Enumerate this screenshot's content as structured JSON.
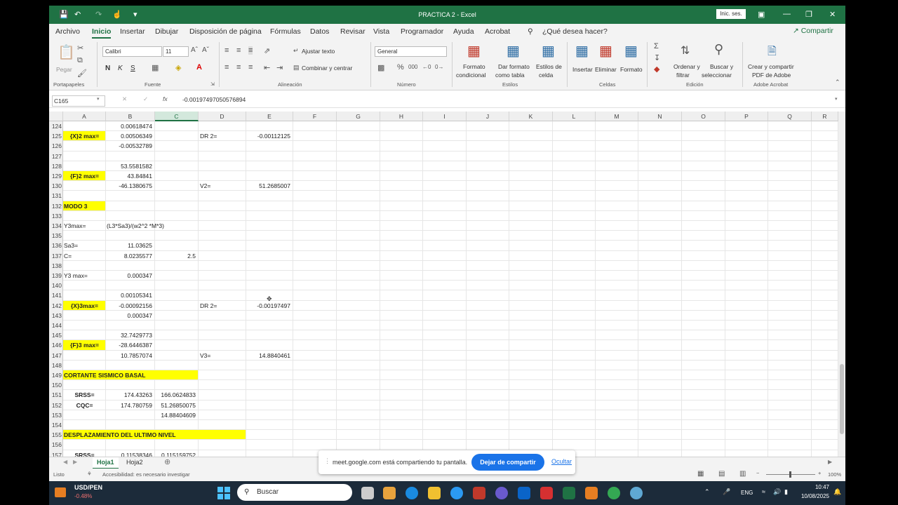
{
  "titlebar": {
    "title": "PRACTICA 2  -  Excel",
    "signin": "Inic. ses."
  },
  "menu": {
    "tabs": [
      "Archivo",
      "Inicio",
      "Insertar",
      "Dibujar",
      "Disposición de página",
      "Fórmulas",
      "Datos",
      "Revisar",
      "Vista",
      "Programador",
      "Ayuda",
      "Acrobat"
    ],
    "active_tab": "Inicio",
    "tell_me": "¿Qué desea hacer?",
    "share": "Compartir"
  },
  "ribbon": {
    "paste": "Pegar",
    "font_name": "Calibri",
    "font_size": "11",
    "bold": "N",
    "italic": "K",
    "underline": "S",
    "wrap_text": "Ajustar texto",
    "merge_center": "Combinar y centrar",
    "number_format": "General",
    "conditional_format_1": "Formato",
    "conditional_format_2": "condicional",
    "format_table_1": "Dar formato",
    "format_table_2": "como tabla",
    "cell_styles_1": "Estilos de",
    "cell_styles_2": "celda",
    "insert": "Insertar",
    "delete": "Eliminar",
    "format": "Formato",
    "sort_1": "Ordenar y",
    "sort_2": "filtrar",
    "find_1": "Buscar y",
    "find_2": "seleccionar",
    "pdf_1": "Crear y compartir",
    "pdf_2": "PDF de Adobe",
    "groups": [
      "Portapapeles",
      "Fuente",
      "Alineación",
      "Número",
      "Estilos",
      "Celdas",
      "Edición",
      "Adobe Acrobat"
    ]
  },
  "formula_bar": {
    "name_box": "C165",
    "fx": "fx",
    "formula": "-0.00197497050576894"
  },
  "columns": [
    "A",
    "B",
    "C",
    "D",
    "E",
    "F",
    "G",
    "H",
    "I",
    "J",
    "K",
    "L",
    "M",
    "N",
    "O",
    "P",
    "Q",
    "R"
  ],
  "selected_column": "C",
  "rows": [
    {
      "n": "124",
      "A": "",
      "B": "0.00618474",
      "C": "",
      "D": "",
      "E": ""
    },
    {
      "n": "125",
      "A": "{X}2 max=",
      "B": "0.00506349",
      "C": "",
      "D": "DR 2=",
      "E": "-0.00112125",
      "hlA": true
    },
    {
      "n": "126",
      "A": "",
      "B": "-0.00532789",
      "C": "",
      "D": "",
      "E": ""
    },
    {
      "n": "127",
      "A": "",
      "B": "",
      "C": "",
      "D": "",
      "E": ""
    },
    {
      "n": "128",
      "A": "",
      "B": "53.5581582",
      "C": "",
      "D": "",
      "E": ""
    },
    {
      "n": "129",
      "A": "{F}2 max=",
      "B": "43.84841",
      "C": "",
      "D": "",
      "E": "",
      "hlA": true
    },
    {
      "n": "130",
      "A": "",
      "B": "-46.1380675",
      "C": "",
      "D": "V2=",
      "E": "51.2685007"
    },
    {
      "n": "131",
      "A": "",
      "B": "",
      "C": "",
      "D": "",
      "E": ""
    },
    {
      "n": "132",
      "A": "MODO 3",
      "B": "",
      "C": "",
      "D": "",
      "E": "",
      "hlA": true
    },
    {
      "n": "133",
      "A": "",
      "B": "",
      "C": "",
      "D": "",
      "E": ""
    },
    {
      "n": "134",
      "A": "Y3max=",
      "B": "(L3*Sa3)/(w2^2 *M*3)",
      "C": "",
      "D": "",
      "E": ""
    },
    {
      "n": "135",
      "A": "",
      "B": "",
      "C": "",
      "D": "",
      "E": ""
    },
    {
      "n": "136",
      "A": "Sa3=",
      "B": "11.03625",
      "C": "",
      "D": "",
      "E": ""
    },
    {
      "n": "137",
      "A": "C=",
      "B": "8.0235577",
      "C": "2.5",
      "D": "",
      "E": ""
    },
    {
      "n": "138",
      "A": "",
      "B": "",
      "C": "",
      "D": "",
      "E": ""
    },
    {
      "n": "139",
      "A": "Y3 max=",
      "B": "0.000347",
      "C": "",
      "D": "",
      "E": ""
    },
    {
      "n": "140",
      "A": "",
      "B": "",
      "C": "",
      "D": "",
      "E": ""
    },
    {
      "n": "141",
      "A": "",
      "B": "0.00105341",
      "C": "",
      "D": "",
      "E": ""
    },
    {
      "n": "142",
      "A": "{X}3max=",
      "B": "-0.00092156",
      "C": "",
      "D": "DR 2=",
      "E": "-0.00197497",
      "hlA": true
    },
    {
      "n": "143",
      "A": "",
      "B": "0.000347",
      "C": "",
      "D": "",
      "E": ""
    },
    {
      "n": "144",
      "A": "",
      "B": "",
      "C": "",
      "D": "",
      "E": ""
    },
    {
      "n": "145",
      "A": "",
      "B": "32.7429773",
      "C": "",
      "D": "",
      "E": ""
    },
    {
      "n": "146",
      "A": "{F}3 max=",
      "B": "-28.6446387",
      "C": "",
      "D": "",
      "E": "",
      "hlA": true
    },
    {
      "n": "147",
      "A": "",
      "B": "10.7857074",
      "C": "",
      "D": "V3=",
      "E": "14.8840461"
    },
    {
      "n": "148",
      "A": "",
      "B": "",
      "C": "",
      "D": "",
      "E": ""
    },
    {
      "n": "149",
      "A": "CORTANTE SISMICO BASAL",
      "B": "",
      "C": "",
      "D": "",
      "E": "",
      "hlWide": "2"
    },
    {
      "n": "150",
      "A": "",
      "B": "",
      "C": "",
      "D": "",
      "E": ""
    },
    {
      "n": "151",
      "A": "SRSS=",
      "B": "174.43263",
      "C": "166.0624833",
      "D": "",
      "E": "",
      "boldA": true
    },
    {
      "n": "152",
      "A": "CQC=",
      "B": "174.780759",
      "C": "51.26850075",
      "D": "",
      "E": "",
      "boldA": true
    },
    {
      "n": "153",
      "A": "",
      "B": "",
      "C": "14.88404609",
      "D": "",
      "E": ""
    },
    {
      "n": "154",
      "A": "",
      "B": "",
      "C": "",
      "D": "",
      "E": ""
    },
    {
      "n": "155",
      "A": "DESPLAZAMIENTO DEL ULTIMO NIVEL",
      "B": "",
      "C": "",
      "D": "",
      "E": "",
      "hlWide": "3"
    },
    {
      "n": "156",
      "A": "",
      "B": "",
      "C": "",
      "D": "",
      "E": ""
    },
    {
      "n": "157",
      "A": "SRSS=",
      "B": "0.11538346",
      "C": "0.115159752",
      "D": "",
      "E": "",
      "boldA": true
    }
  ],
  "sheets": [
    "Hoja1",
    "Hoja2"
  ],
  "active_sheet": "Hoja1",
  "status": {
    "ready": "Listo",
    "accessibility": "Accesibilidad: es necesario investigar",
    "zoom": "100%"
  },
  "meet_banner": {
    "text": "meet.google.com está compartiendo tu pantalla.",
    "stop_button": "Dejar de compartir",
    "hide_link": "Ocultar"
  },
  "taskbar": {
    "ticker": "USD/PEN",
    "ticker_change": "-0.48%",
    "search_placeholder": "Buscar",
    "language": "ENG",
    "time": "10:47",
    "date": "10/08/2025"
  }
}
